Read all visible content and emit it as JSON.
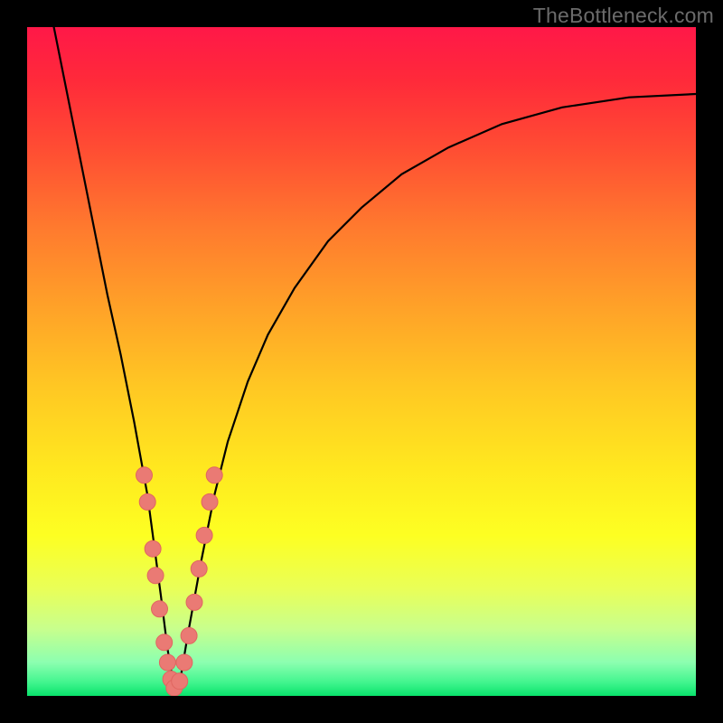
{
  "watermark": "TheBottleneck.com",
  "colors": {
    "frame": "#000000",
    "curve": "#000000",
    "marker_fill": "#ea7a74",
    "marker_stroke": "#e06660",
    "gradient_stops": [
      "#ff1848",
      "#ff2a3a",
      "#ff4c33",
      "#ff7a2e",
      "#ffa228",
      "#ffc823",
      "#ffe81f",
      "#fdff22",
      "#e9ff58",
      "#c8ff8d",
      "#8cffb0",
      "#41f58e",
      "#09e26b"
    ]
  },
  "chart_data": {
    "type": "line",
    "title": "",
    "xlabel": "",
    "ylabel": "",
    "xlim": [
      0,
      100
    ],
    "ylim": [
      0,
      100
    ],
    "note": "Axes are unlabeled in the image; values are read as percentages of the plot area. The curve depicts a V-shaped bottleneck plot reaching ~0 near x≈22, with clustered markers on the valley walls.",
    "series": [
      {
        "name": "bottleneck-curve",
        "x": [
          4,
          6,
          8,
          10,
          12,
          14,
          16,
          18,
          20,
          21,
          22,
          23,
          24,
          26,
          28,
          30,
          33,
          36,
          40,
          45,
          50,
          56,
          63,
          71,
          80,
          90,
          100
        ],
        "y": [
          100,
          90,
          80,
          70,
          60,
          51,
          41,
          30,
          15,
          7,
          1,
          3,
          9,
          20,
          30,
          38,
          47,
          54,
          61,
          68,
          73,
          78,
          82,
          85.5,
          88,
          89.5,
          90
        ]
      }
    ],
    "markers": [
      {
        "x": 17.5,
        "y": 33
      },
      {
        "x": 18.0,
        "y": 29
      },
      {
        "x": 18.8,
        "y": 22
      },
      {
        "x": 19.2,
        "y": 18
      },
      {
        "x": 19.8,
        "y": 13
      },
      {
        "x": 20.5,
        "y": 8
      },
      {
        "x": 21.0,
        "y": 5
      },
      {
        "x": 21.5,
        "y": 2.5
      },
      {
        "x": 22.0,
        "y": 1.2
      },
      {
        "x": 22.8,
        "y": 2.2
      },
      {
        "x": 23.5,
        "y": 5
      },
      {
        "x": 24.2,
        "y": 9
      },
      {
        "x": 25.0,
        "y": 14
      },
      {
        "x": 25.7,
        "y": 19
      },
      {
        "x": 26.5,
        "y": 24
      },
      {
        "x": 27.3,
        "y": 29
      },
      {
        "x": 28.0,
        "y": 33
      }
    ]
  }
}
